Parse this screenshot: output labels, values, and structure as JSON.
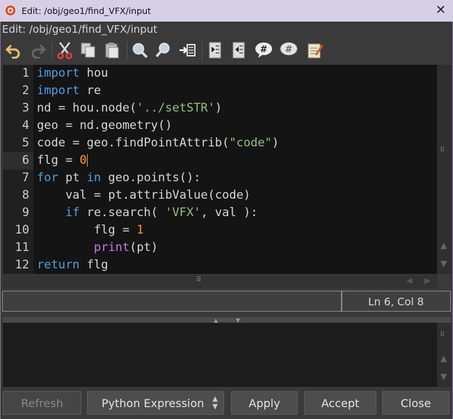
{
  "window": {
    "title": "Edit: /obj/geo1/find_VFX/input",
    "close_glyph": "✕"
  },
  "path_label": "Edit: /obj/geo1/find_VFX/input",
  "toolbar": {
    "icons": [
      "undo-icon",
      "redo-icon",
      "cut-icon",
      "copy-icon",
      "paste-icon",
      "find-icon",
      "find-replace-icon",
      "insert-icon",
      "indent-icon",
      "unindent-icon",
      "comment-icon",
      "uncomment-icon",
      "notes-icon"
    ]
  },
  "editor": {
    "lines": [
      {
        "num": "1",
        "code": "import hou"
      },
      {
        "num": "2",
        "code": "import re"
      },
      {
        "num": "3",
        "code": "nd = hou.node('../setSTR')"
      },
      {
        "num": "4",
        "code": "geo = nd.geometry()"
      },
      {
        "num": "5",
        "code": "code = geo.findPointAttrib(\"code\")"
      },
      {
        "num": "6",
        "code": "flg = 0"
      },
      {
        "num": "7",
        "code": "for pt in geo.points():"
      },
      {
        "num": "8",
        "code": "    val = pt.attribValue(code)"
      },
      {
        "num": "9",
        "code": "    if re.search( 'VFX', val ):"
      },
      {
        "num": "10",
        "code": "        flg = 1"
      },
      {
        "num": "11",
        "code": "        print(pt)"
      },
      {
        "num": "12",
        "code": "return flg"
      }
    ],
    "current_line": 6
  },
  "status": {
    "position": "Ln 6, Col 8"
  },
  "buttons": {
    "refresh": "Refresh",
    "language": "Python Expression",
    "apply": "Apply",
    "accept": "Accept",
    "close": "Close"
  },
  "colors": {
    "keyword": "#4aa3e6",
    "string": "#8fc27a",
    "number": "#f0a030",
    "builtin": "#c878e8"
  }
}
